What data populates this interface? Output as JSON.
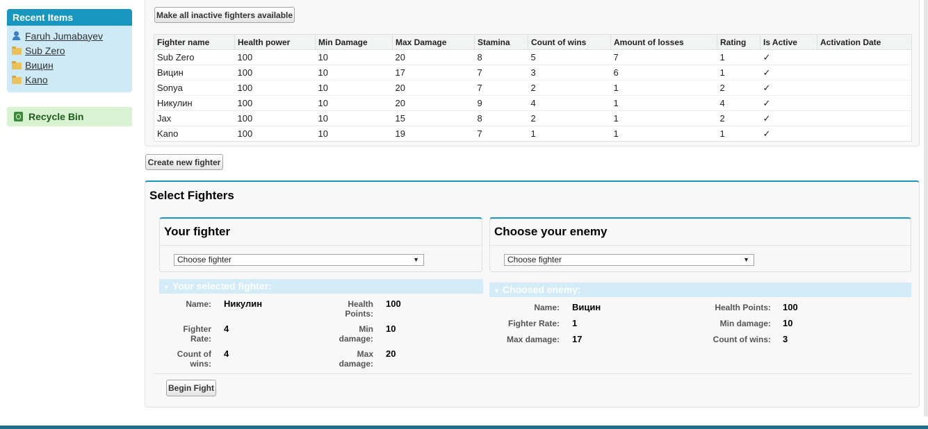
{
  "sidebar": {
    "recent_title": "Recent Items",
    "recent_items": [
      {
        "label": "Faruh Jumabayev",
        "icon": "user-icon"
      },
      {
        "label": "Sub Zero",
        "icon": "folder-icon"
      },
      {
        "label": "Вицин",
        "icon": "folder-icon"
      },
      {
        "label": "Kano",
        "icon": "folder-icon"
      }
    ],
    "recycle_label": "Recycle Bin"
  },
  "top": {
    "make_available_label": "Make all inactive fighters available",
    "create_label": "Create new fighter"
  },
  "table": {
    "columns": [
      "Fighter name",
      "Health power",
      "Min Damage",
      "Max Damage",
      "Stamina",
      "Count of wins",
      "Amount of losses",
      "Rating",
      "Is Active",
      "Activation Date"
    ],
    "rows": [
      [
        "Sub Zero",
        "100",
        "10",
        "20",
        "8",
        "5",
        "7",
        "1",
        "✓",
        ""
      ],
      [
        "Вицин",
        "100",
        "10",
        "17",
        "7",
        "3",
        "6",
        "1",
        "✓",
        ""
      ],
      [
        "Sonya",
        "100",
        "10",
        "20",
        "7",
        "2",
        "1",
        "2",
        "✓",
        ""
      ],
      [
        "Никулин",
        "100",
        "10",
        "20",
        "9",
        "4",
        "1",
        "4",
        "✓",
        ""
      ],
      [
        "Jax",
        "100",
        "10",
        "15",
        "8",
        "2",
        "1",
        "2",
        "✓",
        ""
      ],
      [
        "Kano",
        "100",
        "10",
        "19",
        "7",
        "1",
        "1",
        "1",
        "✓",
        ""
      ]
    ]
  },
  "select": {
    "title": "Select Fighters",
    "your_title": "Your fighter",
    "enemy_title": "Choose your enemy",
    "your_select": "Choose fighter",
    "enemy_select": "Choose fighter",
    "your_section": "Your selected fighter:",
    "enemy_section": "Choosed enemy:",
    "your": {
      "name_label": "Name:",
      "name": "Никулин",
      "health_label_1": "Health",
      "health_label_2": "Points:",
      "health": "100",
      "rate_label_1": "Fighter",
      "rate_label_2": "Rate:",
      "rate": "4",
      "min_label_1": "Min",
      "min_label_2": "damage:",
      "min": "10",
      "wins_label_1": "Count of",
      "wins_label_2": "wins:",
      "wins": "4",
      "max_label_1": "Max",
      "max_label_2": "damage:",
      "max": "20"
    },
    "enemy": {
      "name_label": "Name:",
      "name": "Вицин",
      "health_label": "Health Points:",
      "health": "100",
      "rate_label": "Fighter Rate:",
      "rate": "1",
      "min_label": "Min damage:",
      "min": "10",
      "max_label": "Max damage:",
      "max": "17",
      "wins_label": "Count of wins:",
      "wins": "3"
    },
    "begin_label": "Begin Fight"
  }
}
